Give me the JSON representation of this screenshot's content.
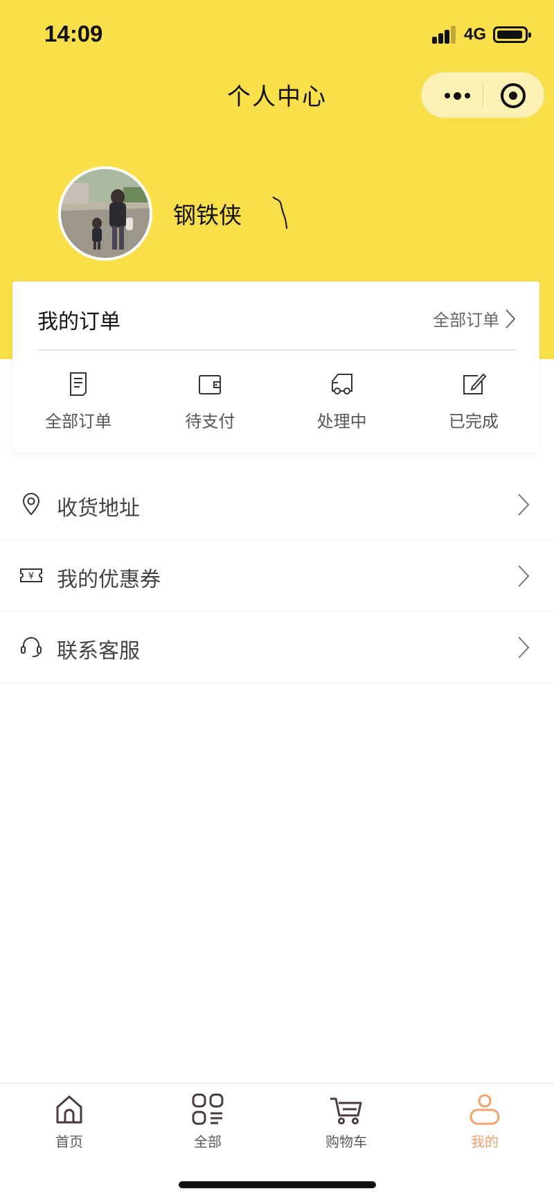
{
  "status_bar": {
    "time": "14:09",
    "network": "4G"
  },
  "nav": {
    "title": "个人中心",
    "more_icon": "more-icon",
    "target_icon": "target-icon"
  },
  "profile": {
    "name": "钢铁侠"
  },
  "orders": {
    "title": "我的订单",
    "all_link": "全部订单",
    "items": [
      {
        "label": "全部订单",
        "icon": "document-icon"
      },
      {
        "label": "待支付",
        "icon": "wallet-icon"
      },
      {
        "label": "处理中",
        "icon": "truck-icon"
      },
      {
        "label": "已完成",
        "icon": "edit-icon"
      }
    ]
  },
  "menu": {
    "items": [
      {
        "label": "收货地址",
        "icon": "location-icon"
      },
      {
        "label": "我的优惠券",
        "icon": "coupon-icon"
      },
      {
        "label": "联系客服",
        "icon": "headset-icon"
      }
    ]
  },
  "tabbar": {
    "items": [
      {
        "label": "首页",
        "icon": "home-icon"
      },
      {
        "label": "全部",
        "icon": "grid-list-icon"
      },
      {
        "label": "购物车",
        "icon": "cart-icon"
      },
      {
        "label": "我的",
        "icon": "user-icon"
      }
    ],
    "active_index": 3
  },
  "colors": {
    "header_bg": "#f9df4a",
    "active_tab": "#f2a26a",
    "icon_dark": "#4a3a3a"
  }
}
